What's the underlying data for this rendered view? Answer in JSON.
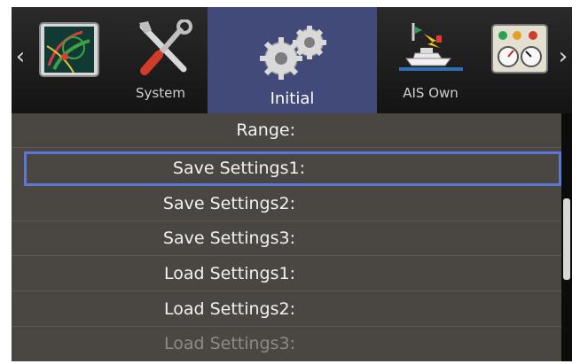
{
  "nav": {
    "prev_arrow": "‹",
    "next_arrow": "›",
    "tabs": [
      {
        "label": "",
        "icon": "radar-icon"
      },
      {
        "label": "System",
        "icon": "wrench-screwdriver-icon"
      },
      {
        "label": "Initial",
        "icon": "gears-icon",
        "active": true
      },
      {
        "label": "AIS Own",
        "icon": "boat-icon"
      },
      {
        "label": "",
        "icon": "gauges-icon"
      }
    ]
  },
  "menu": {
    "items": [
      {
        "label": "Range:"
      },
      {
        "label": "Save Settings1:",
        "selected": true
      },
      {
        "label": "Save Settings2:"
      },
      {
        "label": "Save Settings3:"
      },
      {
        "label": "Load Settings1:"
      },
      {
        "label": "Load Settings2:"
      },
      {
        "label": "Load Settings3:",
        "dimmed": true
      }
    ]
  },
  "colors": {
    "background": "#4a4742",
    "active_tab": "#414a78",
    "selection_border": "#5b78d6",
    "text": "#f2f2f2",
    "dimmed_text": "#8d8a85"
  }
}
